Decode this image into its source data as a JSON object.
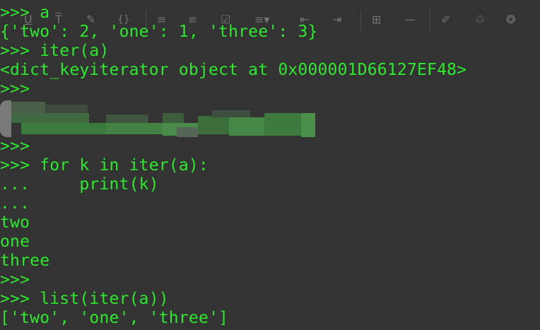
{
  "console": {
    "lines": [
      ">>> a",
      "{'two': 2, 'one': 1, 'three': 3}",
      ">>> iter(a)",
      "<dict_keyiterator object at 0x000001D66127EF48>",
      ">>>",
      ">>>",
      ">>> for k in iter(a):",
      "...     print(k)",
      "...",
      "two",
      "one",
      "three",
      ">>>",
      ">>> list(iter(a))",
      "['two', 'one', 'three']"
    ]
  },
  "toolbar": {
    "icons": [
      "underline-icon",
      "strikethrough-icon",
      "highlighter-icon",
      "code-braces-icon",
      "bullet-list-icon",
      "numbered-list-icon",
      "checklist-icon",
      "align-dropdown-icon",
      "outdent-icon",
      "indent-icon",
      "table-icon",
      "horizontal-rule-icon",
      "attachment-icon",
      "stamp-icon",
      "aperture-icon"
    ]
  },
  "colors": {
    "background": "#333333",
    "text": "#2ee82e",
    "toolbar_icon": "#8a8a8a"
  }
}
